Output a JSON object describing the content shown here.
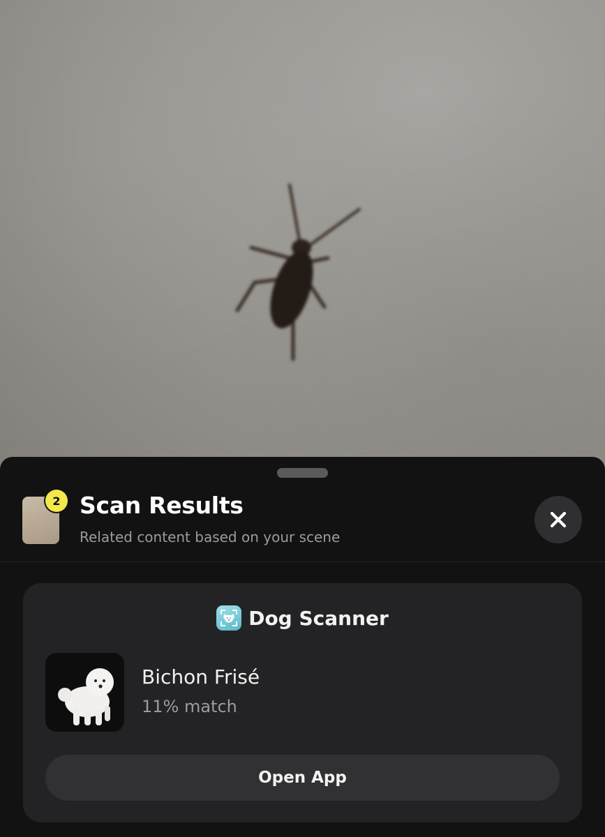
{
  "header": {
    "title": "Scan Results",
    "subtitle": "Related content based on your scene",
    "scan_count": "2"
  },
  "icons": {
    "close": "close-icon",
    "app": "dog-scanner-app-icon"
  },
  "result_card": {
    "app_name": "Dog Scanner",
    "result": {
      "name": "Bichon Frisé",
      "match": "11% match"
    },
    "open_button_label": "Open App"
  },
  "colors": {
    "sheet_background": "#121212",
    "card_background": "#232325",
    "badge_yellow": "#f4e84a",
    "app_icon_teal": "#57b8c9"
  }
}
